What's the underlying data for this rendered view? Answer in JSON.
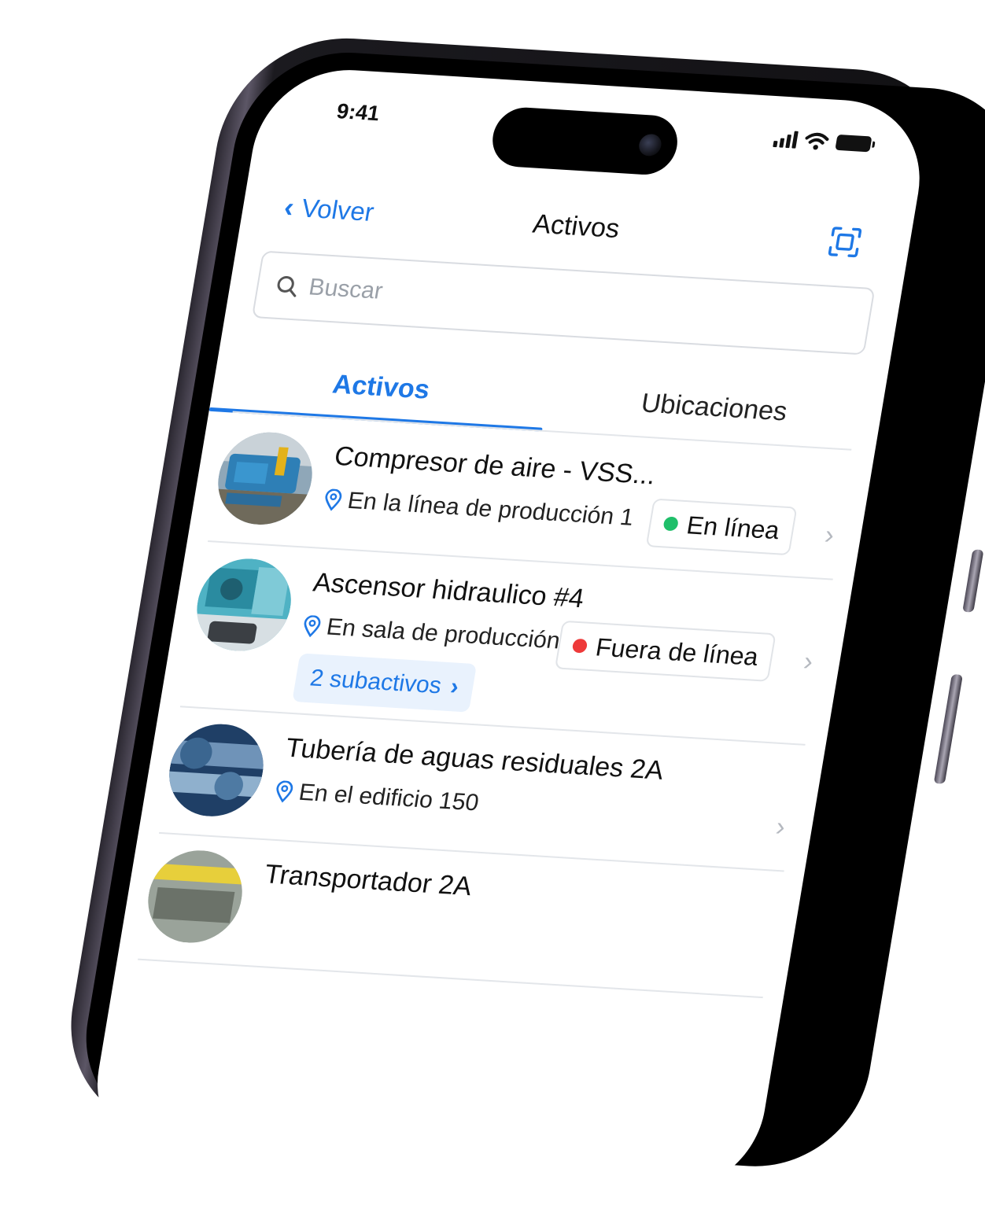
{
  "status_bar": {
    "time": "9:41",
    "signal_icon": "cellular-signal-icon",
    "wifi_icon": "wifi-icon",
    "battery_icon": "battery-icon"
  },
  "nav": {
    "back_label": "Volver",
    "title": "Activos",
    "scan_icon": "scan-icon"
  },
  "search": {
    "placeholder": "Buscar",
    "icon": "search-icon"
  },
  "tabs": [
    {
      "label": "Activos",
      "active": true
    },
    {
      "label": "Ubicaciones",
      "active": false
    }
  ],
  "assets": [
    {
      "name": "Compresor de aire - VSS...",
      "location": "En la línea de producción 1",
      "status": "En línea",
      "status_color": "#1fbf6a"
    },
    {
      "name": "Ascensor hidraulico #4",
      "location": "En sala de producción",
      "status": "Fuera de línea",
      "status_color": "#ee3a3a",
      "subassets": "2 subactivos"
    },
    {
      "name": "Tubería de aguas residuales 2A",
      "location": "En el edificio 150"
    },
    {
      "name": "Transportador 2A",
      "location": ""
    }
  ],
  "colors": {
    "accent": "#1e78e6",
    "online": "#1fbf6a",
    "offline": "#ee3a3a"
  }
}
